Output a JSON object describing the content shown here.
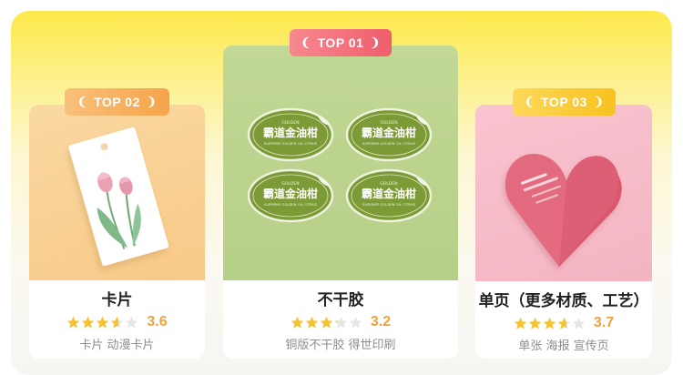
{
  "colors": {
    "panel_top": "#fde94a",
    "star_filled": "#f6c232",
    "star_empty": "#e6e6e6",
    "score": "#f0a23c",
    "badge_top1": "#ef5e6c",
    "badge_top2": "#f5a44a",
    "badge_top3": "#f8c11f"
  },
  "cards": [
    {
      "badge": "TOP 02",
      "title": "卡片",
      "rating": 3.6,
      "score_text": "3.6",
      "subtitle": "卡片 动漫卡片"
    },
    {
      "badge": "TOP 01",
      "title": "不干胶",
      "rating": 3.2,
      "score_text": "3.2",
      "subtitle": "铜版不干胶 得世印刷",
      "sticker_text": "霸道金油柑",
      "sticker_small": "SUPERME GOLDEN OIL CITRUS",
      "sticker_top": "GOLDEN"
    },
    {
      "badge": "TOP 03",
      "title": "单页（更多材质、工艺）",
      "rating": 3.7,
      "score_text": "3.7",
      "subtitle": "单张 海报 宣传页"
    }
  ]
}
